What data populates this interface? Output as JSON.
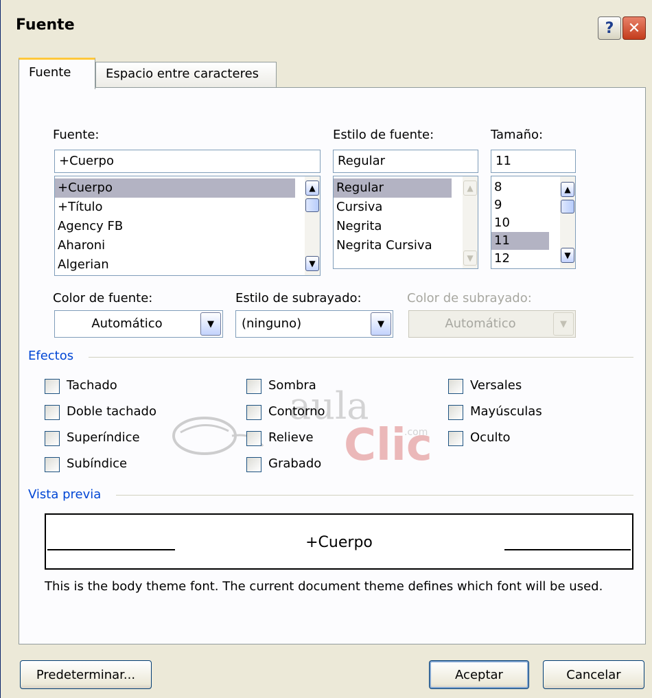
{
  "window": {
    "title": "Fuente",
    "help_glyph": "?",
    "close_glyph": "✕"
  },
  "tabs": [
    {
      "label": "Fuente",
      "active": true
    },
    {
      "label": "Espacio entre caracteres",
      "active": false
    }
  ],
  "font": {
    "label": "Fuente:",
    "value": "+Cuerpo",
    "items": [
      "+Cuerpo",
      "+Título",
      "Agency FB",
      "Aharoni",
      "Algerian"
    ],
    "selected": "+Cuerpo"
  },
  "style": {
    "label": "Estilo de fuente:",
    "value": "Regular",
    "items": [
      "Regular",
      "Cursiva",
      "Negrita",
      "Negrita Cursiva"
    ],
    "selected": "Regular"
  },
  "size": {
    "label": "Tamaño:",
    "value": "11",
    "items": [
      "8",
      "9",
      "10",
      "11",
      "12"
    ],
    "selected": "11"
  },
  "font_color": {
    "label": "Color de fuente:",
    "value": "Automático"
  },
  "underline_style": {
    "label": "Estilo de subrayado:",
    "value": "(ninguno)"
  },
  "underline_color": {
    "label": "Color de subrayado:",
    "value": "Automático",
    "disabled": true
  },
  "effects": {
    "title": "Efectos",
    "items": [
      {
        "label": "Tachado",
        "checked": false
      },
      {
        "label": "Doble tachado",
        "checked": false
      },
      {
        "label": "Superíndice",
        "checked": false
      },
      {
        "label": "Subíndice",
        "checked": false
      },
      {
        "label": "Sombra",
        "checked": false
      },
      {
        "label": "Contorno",
        "checked": false
      },
      {
        "label": "Relieve",
        "checked": false
      },
      {
        "label": "Grabado",
        "checked": false
      },
      {
        "label": "Versales",
        "checked": false
      },
      {
        "label": "Mayúsculas",
        "checked": false
      },
      {
        "label": "Oculto",
        "checked": false
      }
    ]
  },
  "watermark": {
    "brand": "aula",
    "brand2": "Clic",
    "suffix": ".com"
  },
  "preview": {
    "title": "Vista previa",
    "sample": "+Cuerpo",
    "note": "This is the body theme font. The current document theme defines which font will be used."
  },
  "buttons": {
    "default_label": "Predeterminar...",
    "ok_label": "Aceptar",
    "cancel_label": "Cancelar"
  },
  "colors": {
    "accent_blue": "#0046d5",
    "selection": "#b3b3c3",
    "tab_highlight": "#ffc83c",
    "close_red": "#c33c1c"
  }
}
